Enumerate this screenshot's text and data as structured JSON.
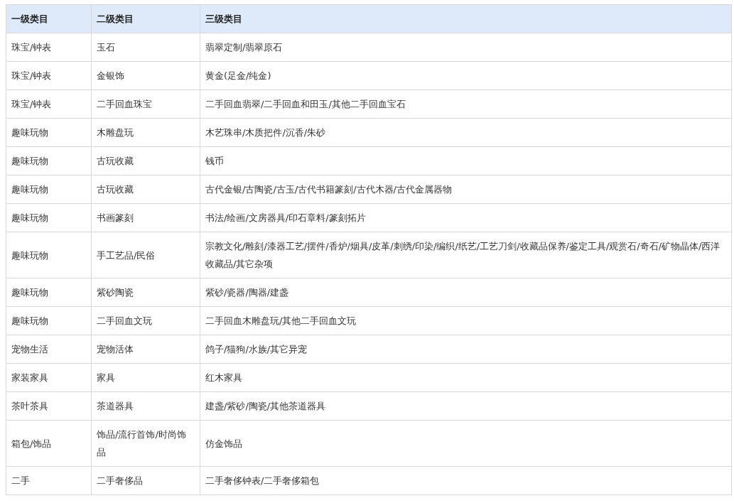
{
  "table": {
    "columns": [
      "一级类目",
      "二级类目",
      "三级类目"
    ],
    "rows": [
      [
        "珠宝/钟表",
        "玉石",
        "翡翠定制/翡翠原石"
      ],
      [
        "珠宝/钟表",
        "金银饰",
        "黄金(足金/纯金)"
      ],
      [
        "珠宝/钟表",
        "二手回血珠宝",
        "二手回血翡翠/二手回血和田玉/其他二手回血宝石"
      ],
      [
        "趣味玩物",
        "木雕盘玩",
        "木艺珠串/木质把件/沉香/朱砂"
      ],
      [
        "趣味玩物",
        "古玩收藏",
        "钱币"
      ],
      [
        "趣味玩物",
        "古玩收藏",
        "古代金银/古陶瓷/古玉/古代书籍篆刻/古代木器/古代金属器物"
      ],
      [
        "趣味玩物",
        "书画篆刻",
        "书法/绘画/文房器具/印石章料/篆刻拓片"
      ],
      [
        "趣味玩物",
        "手工艺品/民俗",
        "宗教文化/雕刻/漆器工艺/摆件/香炉/烟具/皮革/刺绣/印染/编织/纸艺/工艺刀剑/收藏品保养/鉴定工具/观赏石/奇石/矿物晶体/西洋收藏品/其它杂项"
      ],
      [
        "趣味玩物",
        "紫砂陶瓷",
        "紫砂/瓷器/陶器/建盏"
      ],
      [
        "趣味玩物",
        "二手回血文玩",
        "二手回血木雕盘玩/其他二手回血文玩"
      ],
      [
        "宠物生活",
        "宠物活体",
        "鸽子/猫狗/水族/其它异宠"
      ],
      [
        "家装家具",
        "家具",
        "红木家具"
      ],
      [
        "茶叶茶具",
        "茶道器具",
        "建盏/紫砂/陶瓷/其他茶道器具"
      ],
      [
        "箱包/饰品",
        "饰品/流行首饰/时尚饰品",
        "仿金饰品"
      ],
      [
        "二手",
        "二手奢侈品",
        "二手奢侈钟表/二手奢侈箱包"
      ]
    ]
  }
}
